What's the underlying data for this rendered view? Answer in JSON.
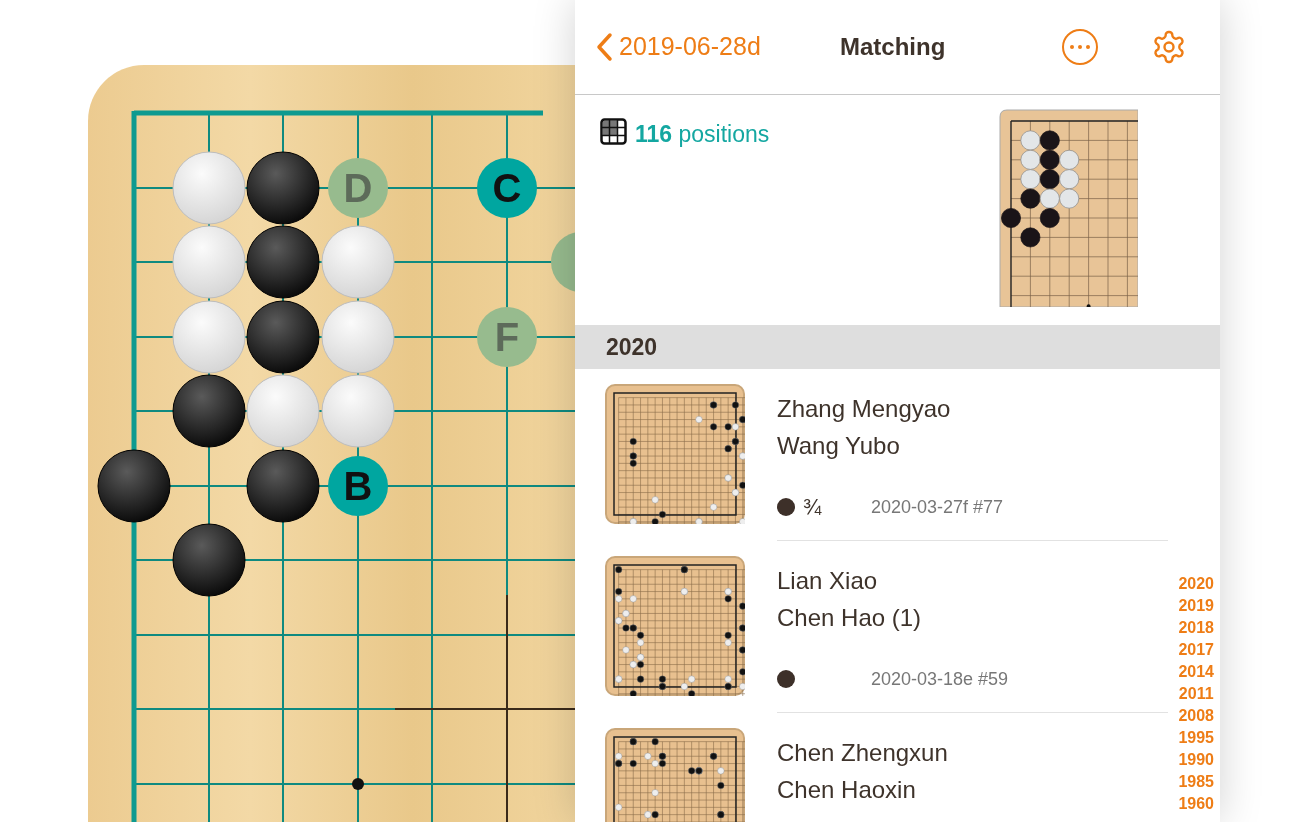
{
  "board": {
    "markers": [
      {
        "label": "D",
        "kind": "alternative"
      },
      {
        "label": "C",
        "kind": "primary"
      },
      {
        "kind": "alternative"
      },
      {
        "label": "F",
        "kind": "alternative"
      },
      {
        "label": "B",
        "kind": "primary"
      }
    ]
  },
  "header": {
    "back_label": "2019-06-28d",
    "title": "Matching"
  },
  "summary": {
    "count": "116",
    "label": "positions"
  },
  "sections": [
    {
      "title": "2020",
      "games": [
        {
          "player_1": "Zhang Mengyao",
          "player_2": "Wang Yubo",
          "color": "#3d3029",
          "result": "¾",
          "reference": "2020-03-27f #77"
        },
        {
          "player_1": "Lian Xiao",
          "player_2": "Chen Hao (1)",
          "color": "#3d3029",
          "reference": "2020-03-18e #59"
        },
        {
          "player_1": "Chen Zhengxun",
          "player_2": "Chen Haoxin"
        }
      ]
    }
  ],
  "year_index": [
    "2020",
    "2019",
    "2018",
    "2017",
    "2014",
    "2011",
    "2008",
    "1995",
    "1990",
    "1985",
    "1960"
  ]
}
